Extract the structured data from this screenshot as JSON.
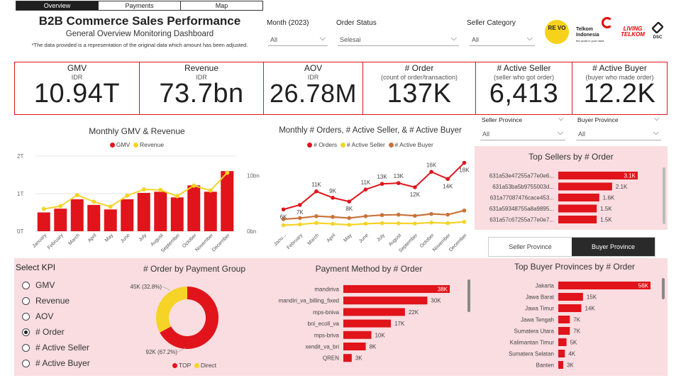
{
  "tabs": [
    {
      "label": "Overview",
      "active": true
    },
    {
      "label": "Payments",
      "active": false
    },
    {
      "label": "Map",
      "active": false
    }
  ],
  "header": {
    "title": "B2B Commerce Sales Performance",
    "subtitle": "General Overview Monitoring Dashboard",
    "disclaimer": "*The data provided is a representation of the original data which amount has been adjusted."
  },
  "filters": {
    "month": {
      "label": "Month (2023)",
      "value": "All"
    },
    "order_status": {
      "label": "Order Status",
      "value": "Selesai"
    },
    "seller_category": {
      "label": "Seller Category",
      "value": "All"
    },
    "seller_province": {
      "label": "Seller Province",
      "value": "All"
    },
    "buyer_province": {
      "label": "Buyer Province",
      "value": "All"
    }
  },
  "logos": {
    "revo": "RE VO",
    "telkom_name": "Telkom Indonesia",
    "telkom_tag": "the world in your hand",
    "living": "LIVING TELKOM",
    "dsc": "DSC"
  },
  "kpis": [
    {
      "title": "GMV",
      "sub": "IDR",
      "value": "10.94T"
    },
    {
      "title": "Revenue",
      "sub": "IDR",
      "value": "73.7bn"
    },
    {
      "title": "AOV",
      "sub": "IDR",
      "value": "26.78M"
    },
    {
      "title": "# Order",
      "sub": "(count of order/transaction)",
      "value": "137K"
    },
    {
      "title": "# Active Seller",
      "sub": "(seller who got order)",
      "value": "6,413"
    },
    {
      "title": "# Active Buyer",
      "sub": "(buyer who made order)",
      "value": "12.2K"
    }
  ],
  "colors": {
    "red": "#e0141a",
    "yellow": "#f5d327",
    "brown": "#c8733a",
    "pink": "#f9dde0",
    "dark": "#2a2a2a"
  },
  "gmv_chart_text": {
    "title": "Monthly GMV & Revenue",
    "legend_gmv": "GMV",
    "legend_rev": "Revenue",
    "left_ticks": [
      "2T",
      "1T",
      "0T"
    ],
    "right_ticks": [
      "10bn",
      "0bn"
    ]
  },
  "orders_chart_text": {
    "title": "Monthly # Orders, # Active Seller, & # Active Buyer",
    "legend_orders": "# Orders",
    "legend_seller": "# Active Seller",
    "legend_buyer": "# Active Buyer"
  },
  "payment_group_text": {
    "title": "# Order by Payment Group",
    "legend_top": "TOP",
    "legend_direct": "Direct"
  },
  "payment_method_text": {
    "title": "Payment Method by # Order"
  },
  "top_sellers_text": {
    "title": "Top Sellers by # Order"
  },
  "top_buyer_text": {
    "title": "Top Buyer Provinces by # Order"
  },
  "province_toggle": {
    "seller": "Seller Province",
    "buyer": "Buyer Province",
    "selected": "buyer"
  },
  "kpi_select": {
    "title": "Select KPI",
    "options": [
      "GMV",
      "Revenue",
      "AOV",
      "# Order",
      "# Active Seller",
      "# Active Buyer"
    ],
    "selected": "# Order"
  },
  "chart_data": [
    {
      "type": "bar",
      "title": "Monthly GMV & Revenue",
      "categories": [
        "January",
        "February",
        "March",
        "April",
        "May",
        "June",
        "July",
        "August",
        "September",
        "October",
        "November",
        "December"
      ],
      "series": [
        {
          "name": "GMV",
          "kind": "bar",
          "axis": "left",
          "unit": "T",
          "values": [
            0.5,
            0.6,
            0.85,
            0.7,
            0.58,
            0.85,
            1.02,
            1.05,
            0.9,
            1.22,
            1.05,
            1.6
          ]
        },
        {
          "name": "Revenue",
          "kind": "line",
          "axis": "right",
          "unit": "bn",
          "values": [
            4.0,
            4.5,
            6.5,
            5.3,
            4.4,
            6.4,
            7.5,
            7.4,
            6.3,
            8.2,
            7.3,
            10.5
          ]
        }
      ],
      "ylim_left": [
        0,
        2
      ],
      "ylim_right": [
        0,
        13.5
      ]
    },
    {
      "type": "line",
      "title": "Monthly # Orders, # Active Seller, & # Active Buyer",
      "categories": [
        "January",
        "February",
        "March",
        "April",
        "May",
        "June",
        "July",
        "August",
        "September",
        "October",
        "November",
        "December"
      ],
      "series": [
        {
          "name": "# Orders",
          "values": [
            5800,
            7000,
            10600,
            8900,
            7900,
            11100,
            12600,
            12800,
            11700,
            15800,
            13900,
            18200
          ],
          "labels": [
            "6K",
            "7K",
            "11K",
            "9K",
            "8K",
            "11K",
            "13K",
            "13K",
            "12K",
            "16K",
            "14K",
            "18K"
          ]
        },
        {
          "name": "# Active Seller",
          "values": [
            1600,
            1800,
            2200,
            1950,
            1700,
            2000,
            2150,
            2100,
            2050,
            2300,
            2150,
            2500
          ]
        },
        {
          "name": "# Active Buyer",
          "values": [
            3200,
            3500,
            4000,
            3800,
            3500,
            4000,
            4300,
            4400,
            4100,
            4600,
            4400,
            5500
          ]
        }
      ],
      "ylim": [
        0,
        20000
      ]
    },
    {
      "type": "pie",
      "title": "# Order by Payment Group",
      "slices": [
        {
          "name": "TOP",
          "value": 92000,
          "label": "92K (67.2%)"
        },
        {
          "name": "Direct",
          "value": 45000,
          "label": "45K (32.8%)"
        }
      ]
    },
    {
      "type": "bar",
      "orientation": "horizontal",
      "title": "Payment Method by # Order",
      "categories": [
        "mandiriva",
        "mandiri_va_billing_fixed",
        "mps-bniva",
        "bni_ecoll_va",
        "mps-briva",
        "xendit_va_bri",
        "QREN"
      ],
      "values": [
        38000,
        30000,
        22000,
        17000,
        10000,
        8000,
        3000
      ],
      "labels": [
        "38K",
        "30K",
        "22K",
        "17K",
        "10K",
        "8K",
        "3K"
      ]
    },
    {
      "type": "bar",
      "orientation": "horizontal",
      "title": "Top Sellers by # Order",
      "categories": [
        "631a53e47255a77e0e6...",
        "631a53ba5b9755003d...",
        "631a77087476cace453...",
        "631a59348755a8a9895...",
        "631a57c67255a77e0e7..."
      ],
      "values": [
        3100,
        2100,
        1600,
        1500,
        1500
      ],
      "labels": [
        "3.1K",
        "2.1K",
        "1.6K",
        "1.5K",
        "1.5K"
      ]
    },
    {
      "type": "bar",
      "orientation": "horizontal",
      "title": "Top Buyer Provinces by # Order",
      "categories": [
        "Jakarta",
        "Jawa Barat",
        "Jawa Timur",
        "Jawa Tengah",
        "Sumatera Utara",
        "Kalimantan Timur",
        "Sumatera Selatan",
        "Banten"
      ],
      "values": [
        56000,
        15000,
        14000,
        7000,
        7000,
        5000,
        4000,
        3000
      ],
      "labels": [
        "56K",
        "15K",
        "14K",
        "7K",
        "7K",
        "5K",
        "4K",
        "3K"
      ]
    }
  ]
}
